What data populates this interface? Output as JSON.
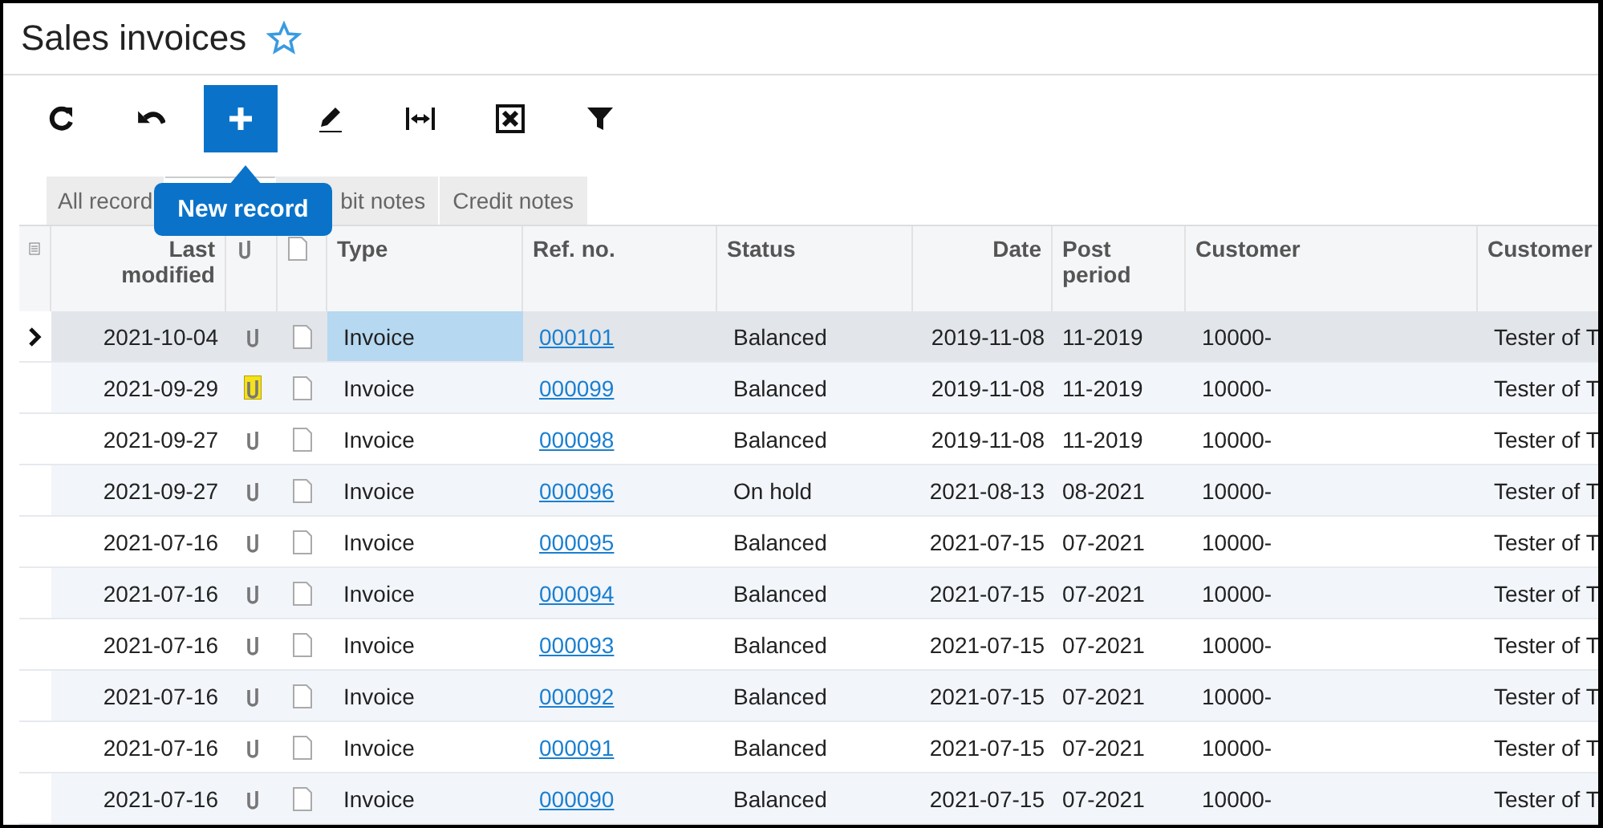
{
  "page": {
    "title": "Sales invoices",
    "favorite": false
  },
  "toolbar": {
    "buttons": [
      {
        "kind": "refresh",
        "selected": false
      },
      {
        "kind": "undo",
        "selected": false
      },
      {
        "kind": "add",
        "selected": true
      },
      {
        "kind": "edit",
        "selected": false
      },
      {
        "kind": "fit",
        "selected": false
      },
      {
        "kind": "excel",
        "selected": false
      },
      {
        "kind": "filter",
        "selected": false
      }
    ],
    "tooltip": "New record"
  },
  "tabs": [
    {
      "label": "All record",
      "selected": false
    },
    {
      "selected": true
    },
    {
      "label": "bit notes",
      "selected": false
    },
    {
      "label": "Credit notes",
      "selected": false
    }
  ],
  "table": {
    "columns": [
      "Last modified",
      "Type",
      "Ref. no.",
      "Status",
      "Date",
      "Post period",
      "Customer",
      "Customer"
    ],
    "rows": [
      {
        "selected": true,
        "attached": false,
        "last_modified": "2021-10-04",
        "type": "Invoice",
        "ref": "000101",
        "status": "Balanced",
        "date": "2019-11-08",
        "period": "11-2019",
        "customer": "10000-",
        "customer_name": "Tester of T"
      },
      {
        "selected": false,
        "attached": true,
        "last_modified": "2021-09-29",
        "type": "Invoice",
        "ref": "000099",
        "status": "Balanced",
        "date": "2019-11-08",
        "period": "11-2019",
        "customer": "10000-",
        "customer_name": "Tester of T"
      },
      {
        "selected": false,
        "attached": false,
        "last_modified": "2021-09-27",
        "type": "Invoice",
        "ref": "000098",
        "status": "Balanced",
        "date": "2019-11-08",
        "period": "11-2019",
        "customer": "10000-",
        "customer_name": "Tester of T"
      },
      {
        "selected": false,
        "attached": false,
        "last_modified": "2021-09-27",
        "type": "Invoice",
        "ref": "000096",
        "status": "On hold",
        "date": "2021-08-13",
        "period": "08-2021",
        "customer": "10000-",
        "customer_name": "Tester of T"
      },
      {
        "selected": false,
        "attached": false,
        "last_modified": "2021-07-16",
        "type": "Invoice",
        "ref": "000095",
        "status": "Balanced",
        "date": "2021-07-15",
        "period": "07-2021",
        "customer": "10000-",
        "customer_name": "Tester of T"
      },
      {
        "selected": false,
        "attached": false,
        "last_modified": "2021-07-16",
        "type": "Invoice",
        "ref": "000094",
        "status": "Balanced",
        "date": "2021-07-15",
        "period": "07-2021",
        "customer": "10000-",
        "customer_name": "Tester of T"
      },
      {
        "selected": false,
        "attached": false,
        "last_modified": "2021-07-16",
        "type": "Invoice",
        "ref": "000093",
        "status": "Balanced",
        "date": "2021-07-15",
        "period": "07-2021",
        "customer": "10000-",
        "customer_name": "Tester of T"
      },
      {
        "selected": false,
        "attached": false,
        "last_modified": "2021-07-16",
        "type": "Invoice",
        "ref": "000092",
        "status": "Balanced",
        "date": "2021-07-15",
        "period": "07-2021",
        "customer": "10000-",
        "customer_name": "Tester of T"
      },
      {
        "selected": false,
        "attached": false,
        "last_modified": "2021-07-16",
        "type": "Invoice",
        "ref": "000091",
        "status": "Balanced",
        "date": "2021-07-15",
        "period": "07-2021",
        "customer": "10000-",
        "customer_name": "Tester of T"
      },
      {
        "selected": false,
        "attached": false,
        "last_modified": "2021-07-16",
        "type": "Invoice",
        "ref": "000090",
        "status": "Balanced",
        "date": "2021-07-15",
        "period": "07-2021",
        "customer": "10000-",
        "customer_name": "Tester of T"
      }
    ]
  }
}
